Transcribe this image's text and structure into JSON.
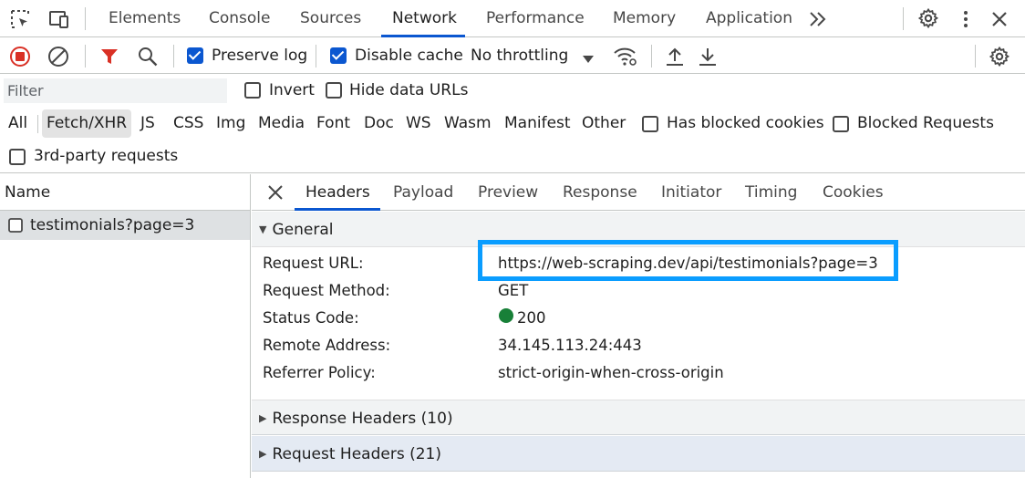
{
  "main_tabs": [
    "Elements",
    "Console",
    "Sources",
    "Network",
    "Performance",
    "Memory",
    "Application"
  ],
  "active_tab": "Network",
  "toolbar": {
    "preserve_log": "Preserve log",
    "disable_cache": "Disable cache",
    "throttling": "No throttling"
  },
  "filter": {
    "placeholder": "Filter",
    "invert": "Invert",
    "hide_data_urls": "Hide data URLs",
    "types": [
      "All",
      "Fetch/XHR",
      "JS",
      "CSS",
      "Img",
      "Media",
      "Font",
      "Doc",
      "WS",
      "Wasm",
      "Manifest",
      "Other"
    ],
    "selected_type": "Fetch/XHR",
    "has_blocked_cookies": "Has blocked cookies",
    "blocked_requests": "Blocked Requests",
    "third_party": "3rd-party requests"
  },
  "requests": {
    "header": "Name",
    "items": [
      "testimonials?page=3"
    ]
  },
  "details": {
    "tabs": [
      "Headers",
      "Payload",
      "Preview",
      "Response",
      "Initiator",
      "Timing",
      "Cookies"
    ],
    "active_tab": "Headers",
    "general_title": "General",
    "general": [
      {
        "key": "Request URL:",
        "value": "https://web-scraping.dev/api/testimonials?page=3"
      },
      {
        "key": "Request Method:",
        "value": "GET"
      },
      {
        "key": "Status Code:",
        "value": "200"
      },
      {
        "key": "Remote Address:",
        "value": "34.145.113.24:443"
      },
      {
        "key": "Referrer Policy:",
        "value": "strict-origin-when-cross-origin"
      }
    ],
    "response_headers": "Response Headers (10)",
    "request_headers": "Request Headers (21)"
  },
  "colors": {
    "accent": "#0b57d0",
    "highlight_box": "#0a9dff",
    "status_ok": "#188038",
    "record_red": "#d93025",
    "filter_red": "#d93025"
  }
}
